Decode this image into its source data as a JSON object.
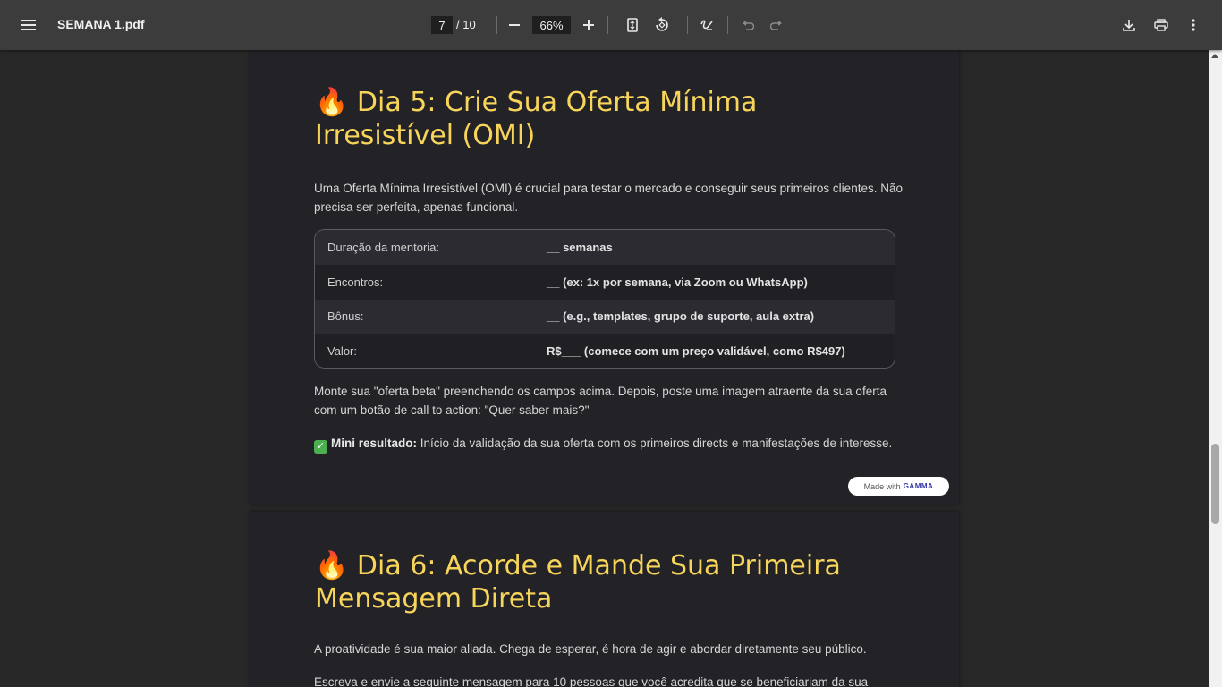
{
  "toolbar": {
    "menu_icon": "hamburger-menu-icon",
    "title": "SEMANA 1.pdf",
    "current_page": "7",
    "page_total": "/ 10",
    "zoom": "66%",
    "icons": [
      "zoom-out-icon",
      "zoom-in-icon",
      "fit-page-icon",
      "rotate-icon",
      "draw-icon",
      "undo-icon",
      "redo-icon",
      "download-icon",
      "print-icon",
      "more-options-icon"
    ]
  },
  "page1": {
    "heading_emoji": "🔥",
    "heading": "Dia 5: Crie Sua Oferta Mínima Irresistível (OMI)",
    "intro": "Uma Oferta Mínima Irresistível (OMI) é crucial para testar o mercado e conseguir seus primeiros clientes. Não precisa ser perfeita, apenas funcional.",
    "table": [
      {
        "label": "Duração da mentoria:",
        "value": "__ semanas"
      },
      {
        "label": "Encontros:",
        "value": "__ (ex: 1x por semana, via Zoom ou WhatsApp)"
      },
      {
        "label": "Bônus:",
        "value": "__ (e.g., templates, grupo de suporte, aula extra)"
      },
      {
        "label": "Valor:",
        "value": "R$___ (comece com um preço validável, como R$497)"
      }
    ],
    "after_table": "Monte sua \"oferta beta\" preenchendo os campos acima. Depois, poste uma imagem atraente da sua oferta com um botão de call to action: \"Quer saber mais?\"",
    "result_emoji": "✅",
    "result_label": "Mini resultado:",
    "result_text": " Início da validação da sua oferta com os primeiros directs e manifestações de interesse.",
    "badge_prefix": "Made with",
    "badge_brand": "GAMMA"
  },
  "page2": {
    "heading_emoji": "🔥",
    "heading": "Dia 6: Acorde e Mande Sua Primeira Mensagem Direta",
    "p1": "A proatividade é sua maior aliada. Chega de esperar, é hora de agir e abordar diretamente seu público.",
    "p2": "Escreva e envie a seguinte mensagem para 10 pessoas que você acredita que se beneficiariam da sua"
  }
}
